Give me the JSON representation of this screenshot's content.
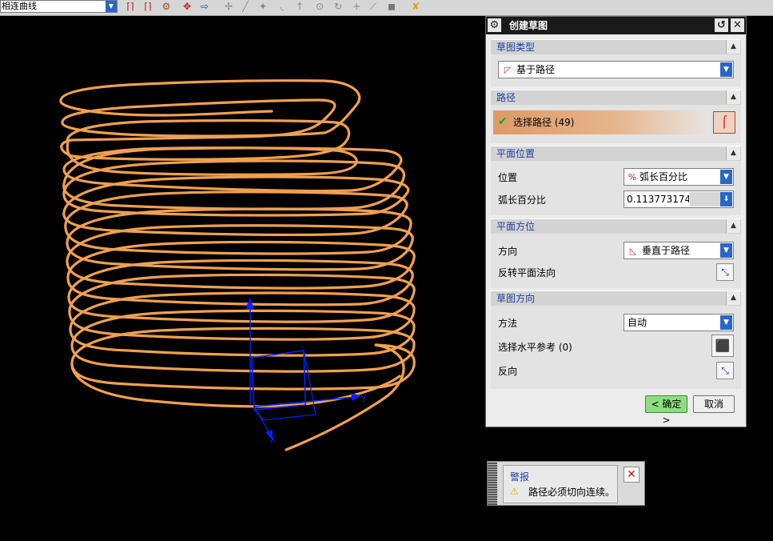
{
  "toolbar": {
    "curve_selector_value": "相连曲线",
    "icons": [
      "curve-rule-icon",
      "curve-rule-icon",
      "gear-curve-icon",
      "snap-icon",
      "arrow-icon",
      "move-icon",
      "line-icon",
      "point-icon",
      "arc-icon",
      "tangent-icon",
      "circle-icon",
      "rotate-icon",
      "plus-icon",
      "slash-icon",
      "cube-icon",
      "cursor-icon"
    ]
  },
  "dialog": {
    "title": "创建草图",
    "sections": {
      "sketch_type": {
        "header": "草图类型",
        "value": "基于路径",
        "icon": "sketch-on-path-icon"
      },
      "path": {
        "header": "路径",
        "select_label": "选择路径 (49)",
        "icon": "select-curve-icon"
      },
      "plane_location": {
        "header": "平面位置",
        "location_label": "位置",
        "location_value": "弧长百分比",
        "arc_percent_label": "弧长百分比",
        "arc_percent_value": "0.1137731740"
      },
      "plane_orientation": {
        "header": "平面方位",
        "direction_label": "方向",
        "direction_value": "垂直于路径",
        "reverse_label": "反转平面法向"
      },
      "sketch_orientation": {
        "header": "草图方向",
        "method_label": "方法",
        "method_value": "自动",
        "horizontal_ref_label": "选择水平参考 (0)",
        "reverse_label": "反向"
      }
    },
    "ok_label": "< 确定 >",
    "cancel_label": "取消"
  },
  "warning": {
    "title": "警报",
    "message": "路径必须切向连续。"
  },
  "viewport": {
    "axis_labels": {
      "x": "X",
      "y": "Y",
      "z": "Z"
    }
  },
  "colors": {
    "curve": "#f0a050",
    "axis": "#0022ff",
    "accent_blue": "#2a66c8",
    "section_header_text": "#1f3f9f",
    "path_selected": "#dc9a68",
    "ok_green": "#8ede80"
  }
}
